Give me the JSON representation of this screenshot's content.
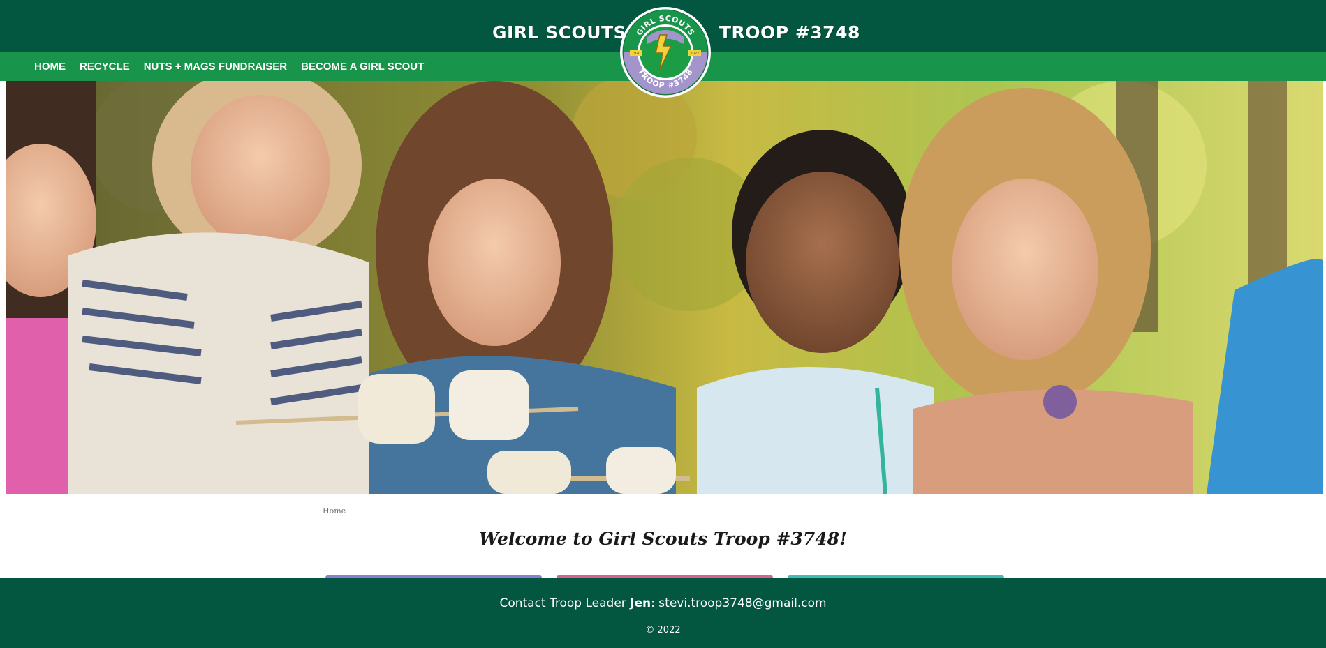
{
  "header": {
    "brand_left": "GIRL SCOUTS",
    "brand_right": "TROOP #3748",
    "logo": {
      "icon": "girl-scouts-troop-badge",
      "top_text": "GIRL SCOUTS",
      "bottom_text": "TROOP #3748",
      "left_small": "1970",
      "right_small": "2022"
    }
  },
  "nav": {
    "items": [
      {
        "label": "HOME"
      },
      {
        "label": "RECYCLE"
      },
      {
        "label": "NUTS + MAGS FUNDRAISER"
      },
      {
        "label": "BECOME A GIRL SCOUT"
      }
    ]
  },
  "hero": {
    "icon": "hero-photo-girls-roasting-marshmallows"
  },
  "breadcrumb": {
    "current": "Home"
  },
  "main": {
    "title": "Welcome to Girl Scouts Troop #3748!"
  },
  "cards": [
    {
      "accent": "#8b7fd1"
    },
    {
      "accent": "#d9618f"
    },
    {
      "accent": "#3cbfb8"
    }
  ],
  "footer": {
    "contact_prefix": "Contact Troop Leader",
    "contact_name": "Jen",
    "contact_email": ": stevi.troop3748@gmail.com",
    "copyright": "© 2022"
  },
  "colors": {
    "dark_green": "#035640",
    "bright_green": "#18954a",
    "badge_purple": "#a394cc",
    "badge_yellow": "#f1d13d"
  }
}
